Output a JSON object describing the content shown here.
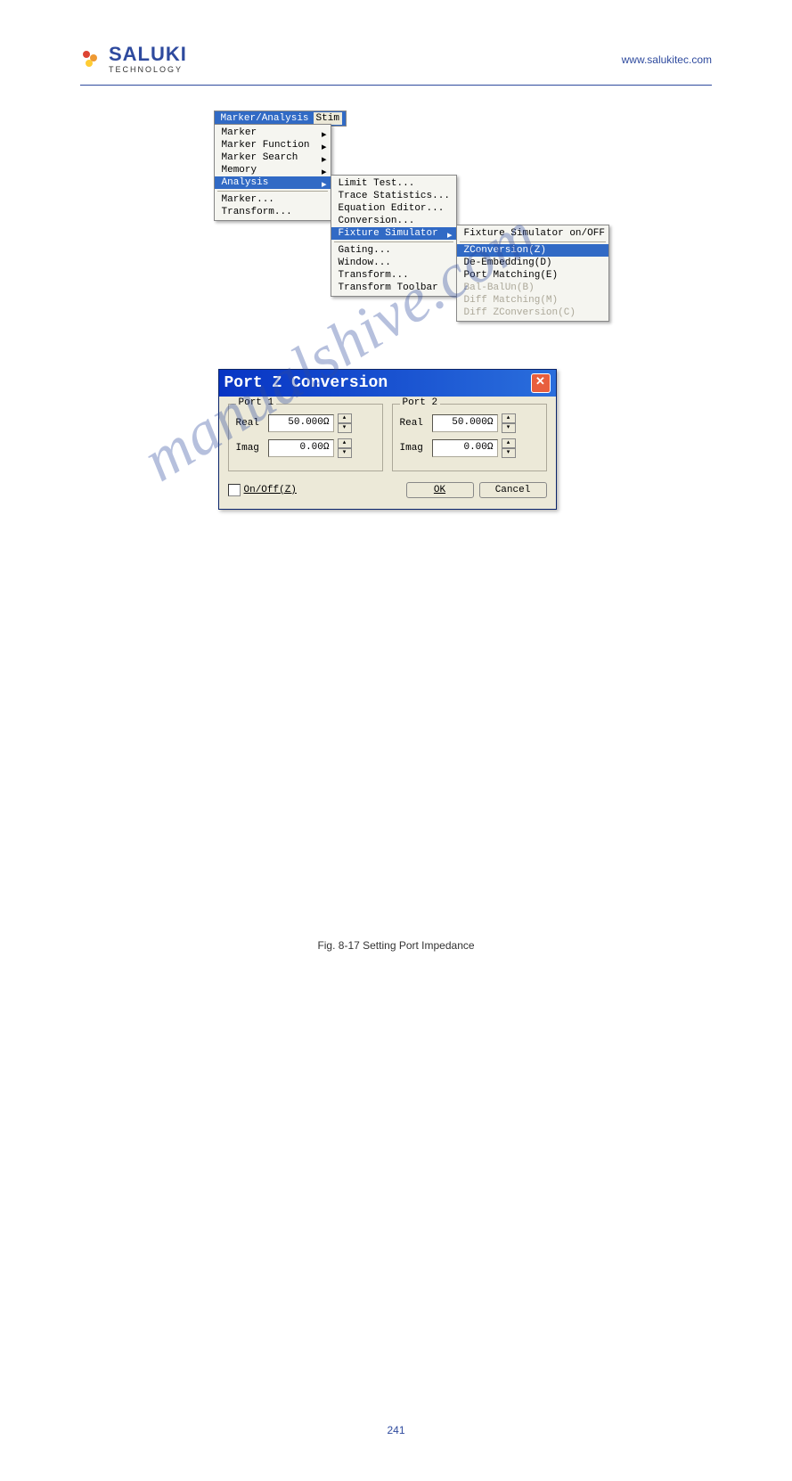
{
  "header": {
    "brand": "SALUKI",
    "brand_sub": "TECHNOLOGY",
    "url": "www.salukitec.com"
  },
  "menubar": {
    "active": "Marker/Analysis",
    "next": "Stim"
  },
  "menu1": {
    "items": [
      "Marker",
      "Marker Function",
      "Marker Search",
      "Memory",
      "Analysis"
    ],
    "extra": [
      "Marker...",
      "Transform..."
    ]
  },
  "menu2": {
    "items": [
      "Limit Test...",
      "Trace Statistics...",
      "Equation Editor...",
      "Conversion...",
      "Fixture Simulator"
    ],
    "extra": [
      "Gating...",
      "Window...",
      "Transform...",
      "Transform Toolbar"
    ]
  },
  "menu3": {
    "items": [
      "Fixture Simulator on/OFF",
      "ZConversion(Z)",
      "De-Embedding(D)",
      "Port Matching(E)",
      "Bal-BalUn(B)",
      "Diff Matching(M)",
      "Diff ZConversion(C)"
    ]
  },
  "dialog": {
    "title": "Port Z Conversion",
    "port1": {
      "label": "Port 1",
      "real_label": "Real",
      "real_value": "50.000Ω",
      "imag_label": "Imag",
      "imag_value": "0.00Ω"
    },
    "port2": {
      "label": "Port 2",
      "real_label": "Real",
      "real_value": "50.000Ω",
      "imag_label": "Imag",
      "imag_value": "0.00Ω"
    },
    "onoff_label": "On/Off(Z)",
    "ok": "OK",
    "cancel": "Cancel"
  },
  "caption": "Fig. 8-17 Setting Port Impedance",
  "watermark": "manualshive.com",
  "page_number": "241"
}
